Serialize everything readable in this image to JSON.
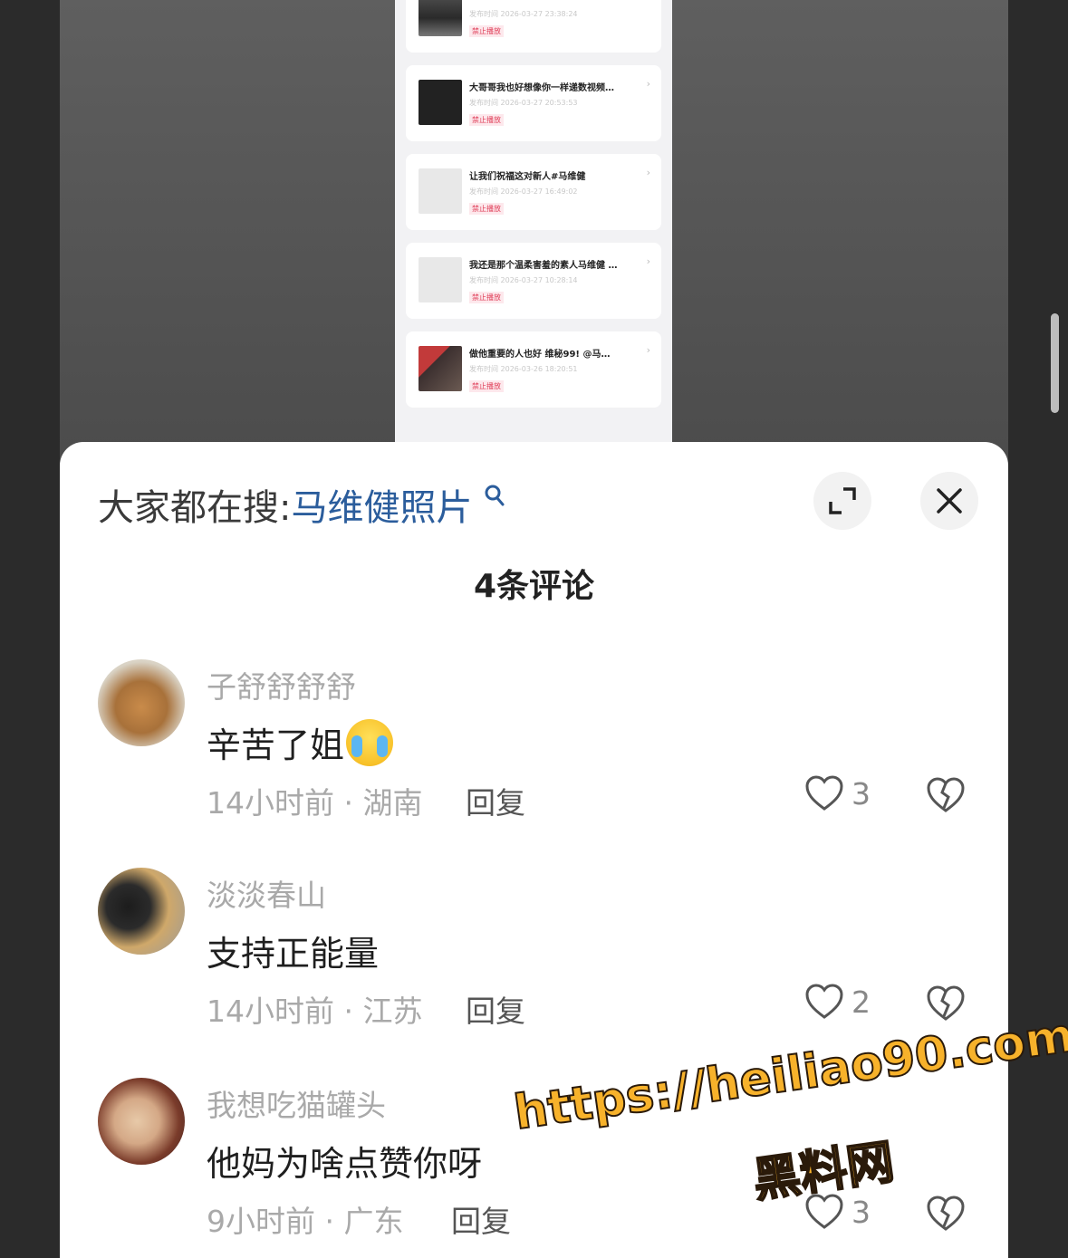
{
  "background_shot": {
    "cards": [
      {
        "title": "…",
        "meta": "发布时间 2026-03-27 23:38:24",
        "tag": "禁止播放"
      },
      {
        "title": "大哥哥我也好想像你一样递数视频…",
        "meta": "发布时间 2026-03-27 20:53:53",
        "tag": "禁止播放"
      },
      {
        "title": "让我们祝福这对新人#马维健",
        "meta": "发布时间 2026-03-27 16:49:02",
        "tag": "禁止播放"
      },
      {
        "title": "我还是那个温柔害羞的素人马维健 …",
        "meta": "发布时间 2026-03-27 10:28:14",
        "tag": "禁止播放"
      },
      {
        "title": "做他重要的人也好 维秘99! @马…",
        "meta": "发布时间 2026-03-26 18:20:51",
        "tag": "禁止播放"
      }
    ]
  },
  "sheet": {
    "search_label": "大家都在搜:",
    "search_term": "马维健照片",
    "search_icon": "search-icon",
    "expand_icon": "expand-icon",
    "close_icon": "close-icon",
    "comment_count_title": "4条评论"
  },
  "comments": [
    {
      "name": "子舒舒舒舒",
      "text": "辛苦了姐",
      "emoji": "crying-laughing-emoji",
      "time_region": "14小时前 · 湖南",
      "reply": "回复",
      "likes": "3"
    },
    {
      "name": "淡淡春山",
      "text": "支持正能量",
      "time_region": "14小时前 · 江苏",
      "reply": "回复",
      "likes": "2"
    },
    {
      "name": "我想吃猫罐头",
      "text": "他妈为啥点赞你呀",
      "time_region": "9小时前 · 广东",
      "reply": "回复",
      "likes": "3"
    }
  ],
  "watermark": {
    "url": "https://heiliao90.com",
    "name": "黑料网",
    "color": "#f7b22b"
  }
}
